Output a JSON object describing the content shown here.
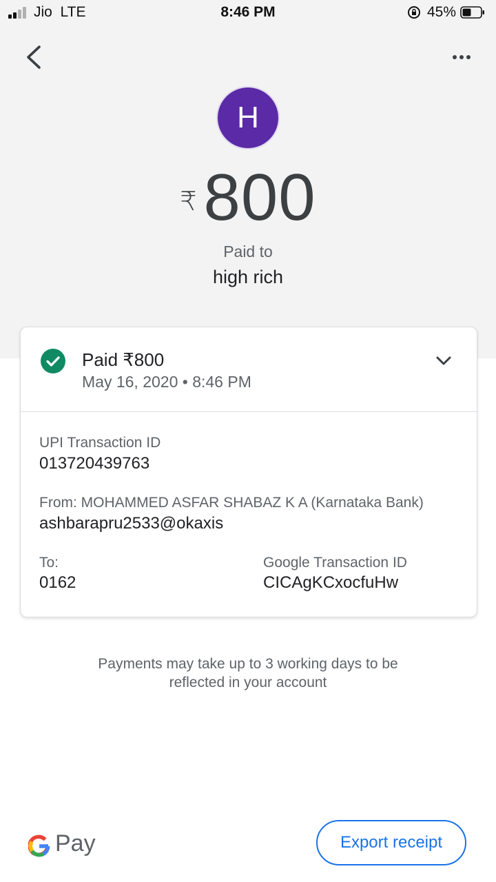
{
  "status_bar": {
    "carrier": "Jio",
    "network": "LTE",
    "time": "8:46 PM",
    "battery_percent": "45%",
    "battery_level": 0.45
  },
  "app_bar": {
    "back_icon": "chevron-left-icon",
    "more_icon": "more-horizontal-icon"
  },
  "payee": {
    "avatar_letter": "H",
    "avatar_color": "#5a2aa7",
    "currency_symbol": "₹",
    "amount": "800",
    "paid_to_label": "Paid to",
    "name": "high rich"
  },
  "transaction": {
    "status_text": "Paid ₹800",
    "status_color": "#188038",
    "datetime": "May 16, 2020 • 8:46 PM",
    "upi_label": "UPI Transaction ID",
    "upi_id": "013720439763",
    "from_label": "From: MOHAMMED ASFAR SHABAZ K A (Karnataka Bank)",
    "from_vpa": "ashbarapru2533@okaxis",
    "to_label": "To:",
    "to_value": "0162",
    "google_txn_label": "Google Transaction ID",
    "google_txn_id": "CICAgKCxocfuHw"
  },
  "note": {
    "line1": "Payments may take up to 3 working days to be",
    "line2": "reflected in your account"
  },
  "footer": {
    "brand_text": "Pay",
    "export_label": "Export receipt",
    "accent_color": "#1a73e8"
  }
}
